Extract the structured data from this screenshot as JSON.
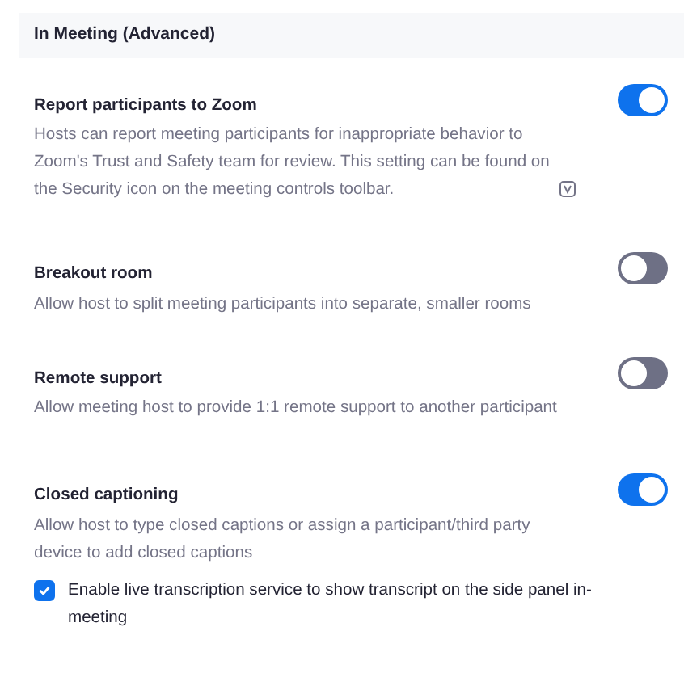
{
  "section": {
    "title": "In Meeting (Advanced)"
  },
  "settings": [
    {
      "title": "Report participants to Zoom",
      "description": "Hosts can report meeting participants for inappropriate behavior to Zoom's Trust and Safety team for review. This setting can be found on the Security icon on the meeting controls toolbar.",
      "info_icon": true,
      "on": true
    },
    {
      "title": "Breakout room",
      "description": "Allow host to split meeting participants into separate, smaller rooms",
      "on": false
    },
    {
      "title": "Remote support",
      "description": "Allow meeting host to provide 1:1 remote support to another participant",
      "on": false
    },
    {
      "title": "Closed captioning",
      "description": "Allow host to type closed captions or assign a participant/third party device to add closed captions",
      "on": true,
      "options": [
        {
          "label": "Enable live transcription service to show transcript on the side panel in-meeting",
          "checked": true
        }
      ]
    }
  ]
}
